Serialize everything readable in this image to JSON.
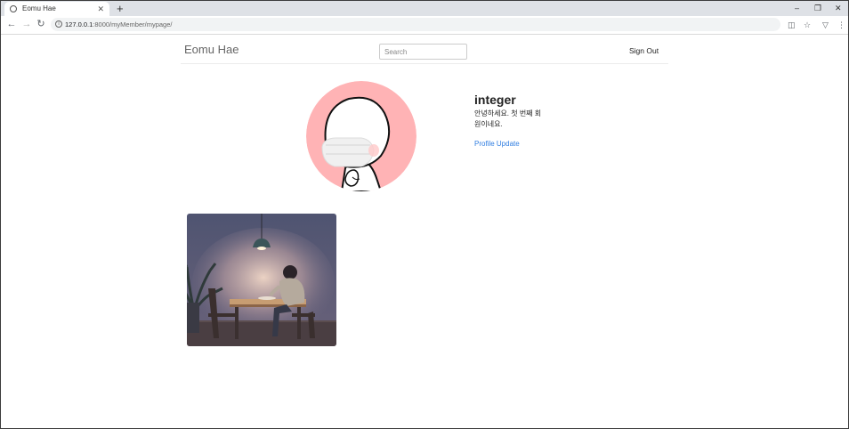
{
  "browser": {
    "tab_title": "Eomu Hae",
    "new_tab_label": "+",
    "url_host": "127.0.0.1",
    "url_path": ":8000/myMember/mypage/"
  },
  "nav": {
    "brand": "Eomu Hae",
    "search_placeholder": "Search",
    "sign_out": "Sign Out"
  },
  "profile": {
    "username": "integer",
    "bio": "안녕하세요. 첫 번째 회원이네요.",
    "update_link": "Profile Update",
    "avatar_bg": "#ffb3b5"
  },
  "colors": {
    "link": "#2f7de1",
    "tabstrip": "#dee1e6"
  }
}
